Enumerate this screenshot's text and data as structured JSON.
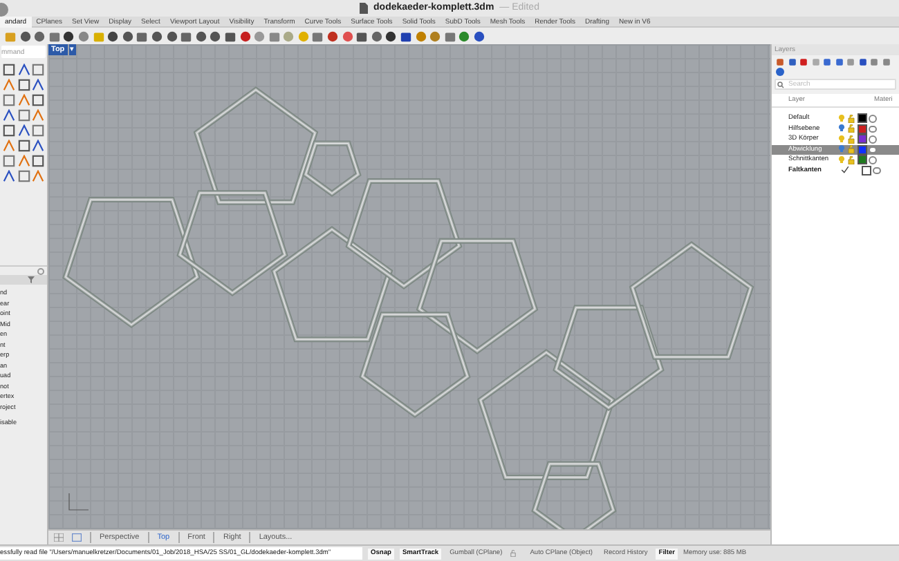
{
  "window": {
    "title": "dodekaeder-komplett.3dm",
    "subtitle": "— Edited"
  },
  "toolbar_tabs": [
    {
      "label": "andard",
      "selected": true
    },
    {
      "label": "CPlanes",
      "selected": false
    },
    {
      "label": "Set View",
      "selected": false
    },
    {
      "label": "Display",
      "selected": false
    },
    {
      "label": "Select",
      "selected": false
    },
    {
      "label": "Viewport Layout",
      "selected": false
    },
    {
      "label": "Visibility",
      "selected": false
    },
    {
      "label": "Transform",
      "selected": false
    },
    {
      "label": "Curve Tools",
      "selected": false
    },
    {
      "label": "Surface Tools",
      "selected": false
    },
    {
      "label": "Solid Tools",
      "selected": false
    },
    {
      "label": "SubD Tools",
      "selected": false
    },
    {
      "label": "Mesh Tools",
      "selected": false
    },
    {
      "label": "Render Tools",
      "selected": false
    },
    {
      "label": "Drafting",
      "selected": false
    },
    {
      "label": "New in V6",
      "selected": false
    }
  ],
  "command": {
    "placeholder": "mmand"
  },
  "osnaps": [
    "nd",
    "ear",
    "oint",
    "Mid",
    "en",
    "nt",
    "erp",
    "an",
    "uad",
    "not",
    "ertex",
    "roject"
  ],
  "osnap_footer": "isable",
  "viewport": {
    "label": "Top",
    "menu": "▾"
  },
  "viewport_tabs": [
    {
      "label": "Perspective",
      "selected": false
    },
    {
      "label": "Top",
      "selected": true
    },
    {
      "label": "Front",
      "selected": false
    },
    {
      "label": "Right",
      "selected": false
    },
    {
      "label": "Layouts...",
      "selected": false
    }
  ],
  "layers": {
    "title": "Layers",
    "search": {
      "placeholder": "Search"
    },
    "columns": [
      "Layer",
      "Materi"
    ],
    "rows": [
      {
        "name": "Default",
        "selected": false,
        "current": false,
        "color": "#000000"
      },
      {
        "name": "Hilfsebene",
        "selected": false,
        "current": false,
        "color": "#cc1f1f"
      },
      {
        "name": "3D Körper",
        "selected": false,
        "current": false,
        "color": "#7a2fd0"
      },
      {
        "name": "Abwicklung",
        "selected": true,
        "current": false,
        "color": "#1030ff"
      },
      {
        "name": "Schnittkanten",
        "selected": false,
        "current": false,
        "color": "#1f7a1f"
      },
      {
        "name": "Faltkanten",
        "selected": false,
        "current": true,
        "color": "#ffffff"
      }
    ]
  },
  "status_bar": {
    "message": "essfully read file \"/Users/manuelkretzer/Documents/01_Job/2018_HSA/25 SS/01_GL/dodekaeder-komplett.3dm\"",
    "toggles": [
      {
        "label": "Osnap",
        "on": true
      },
      {
        "label": "SmartTrack",
        "on": true
      },
      {
        "label": "Gumball (CPlane)",
        "on": false
      },
      {
        "label": "Auto CPlane (Object)",
        "on": false,
        "locked": true
      },
      {
        "label": "Record History",
        "on": false
      },
      {
        "label": "Filter",
        "on": true
      }
    ],
    "memory": "Memory use: 885 MB"
  }
}
